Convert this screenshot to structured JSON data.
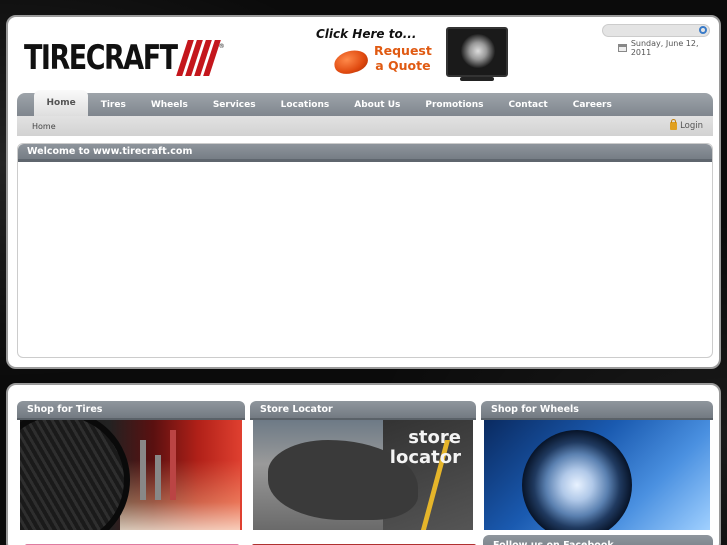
{
  "header": {
    "logo_text": "TIRECRAFT",
    "logo_reg": "®",
    "promo": {
      "click_here": "Click Here to...",
      "request_line1": "Request",
      "request_line2": "a Quote"
    },
    "search": {
      "placeholder": ""
    },
    "date": "Sunday, June 12, 2011"
  },
  "nav": {
    "items": [
      {
        "label": "Home",
        "active": true
      },
      {
        "label": "Tires"
      },
      {
        "label": "Wheels"
      },
      {
        "label": "Services"
      },
      {
        "label": "Locations"
      },
      {
        "label": "About Us"
      },
      {
        "label": "Promotions"
      },
      {
        "label": "Contact"
      },
      {
        "label": "Careers"
      }
    ]
  },
  "subnav": {
    "breadcrumb": "Home",
    "login": "Login"
  },
  "welcome": {
    "title": "Welcome to www.tirecraft.com"
  },
  "boxes": [
    {
      "title": "Shop for Tires"
    },
    {
      "title": "Store Locator",
      "image_text_line1": "store",
      "image_text_line2": "locator"
    },
    {
      "title": "Shop for Wheels"
    }
  ],
  "facebook": {
    "title": "Follow us on Facebook"
  },
  "colors": {
    "brand_red": "#c4161c",
    "nav_gray": "#7f868e",
    "promo_orange": "#e05a12"
  }
}
